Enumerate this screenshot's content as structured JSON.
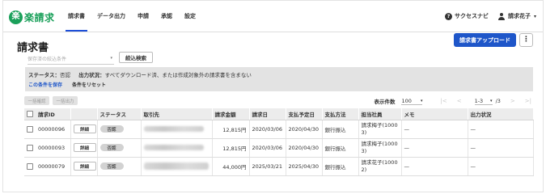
{
  "header": {
    "logo_mark": "楽",
    "logo_text": "楽請求",
    "nav": [
      {
        "label": "請求書",
        "active": true
      },
      {
        "label": "データ出力",
        "active": false
      },
      {
        "label": "申請",
        "active": false
      },
      {
        "label": "承認",
        "active": false
      },
      {
        "label": "設定",
        "active": false
      }
    ],
    "help_icon_glyph": "?",
    "help_label": "サクセスナビ",
    "user_name": "請求花子",
    "user_caret": "▾"
  },
  "page": {
    "title": "請求書",
    "upload_button": "請求書アップロード",
    "kebab_glyph": "⋮"
  },
  "filter": {
    "saved_condition_placeholder": "保存済の絞込条件",
    "dropdown_glyph": "▾",
    "filter_button": "絞込検索",
    "status_label": "ステータス：",
    "status_value": "否認",
    "output_label": "出力状況：",
    "output_value": "すべてダウンロード済、または作成対象外の請求書を含まない",
    "save_condition_link": "この条件を保存",
    "reset_condition_link": "条件をリセット"
  },
  "toolbar": {
    "bulk_approve": "一括確認",
    "bulk_output": "一括出力",
    "per_page_label": "表示件数",
    "per_page_value": "100",
    "per_page_caret": "▾",
    "first_icon": "|<",
    "prev_icon": "<",
    "range_value": "1-3",
    "range_caret": "▾",
    "total": "/3",
    "next_icon": ">",
    "last_icon": ">|"
  },
  "table": {
    "columns": [
      "請求ID",
      "",
      "ステータス",
      "取引先",
      "請求金額",
      "請求日",
      "支払予定日",
      "支払方法",
      "担当社員",
      "メモ",
      "出力状況"
    ],
    "detail_label": "詳細",
    "rows": [
      {
        "id": "00000096",
        "status": "否認",
        "amount": "12,815円",
        "invoice_date": "2020/03/06",
        "due_date": "2020/04/30",
        "payment": "銀行振込",
        "staff": "請求梅子(1000 3)",
        "memo": "—",
        "output": "—"
      },
      {
        "id": "00000093",
        "status": "否認",
        "amount": "12,815円",
        "invoice_date": "2020/03/06",
        "due_date": "2020/04/30",
        "payment": "銀行振込",
        "staff": "請求梅子(1000 3)",
        "memo": "—",
        "output": "—"
      },
      {
        "id": "00000079",
        "status": "否認",
        "amount": "44,000円",
        "invoice_date": "2025/03/21",
        "due_date": "2025/04/30",
        "payment": "銀行振込",
        "staff": "請求花子(1000 2)",
        "memo": "—",
        "output": "—"
      }
    ]
  }
}
